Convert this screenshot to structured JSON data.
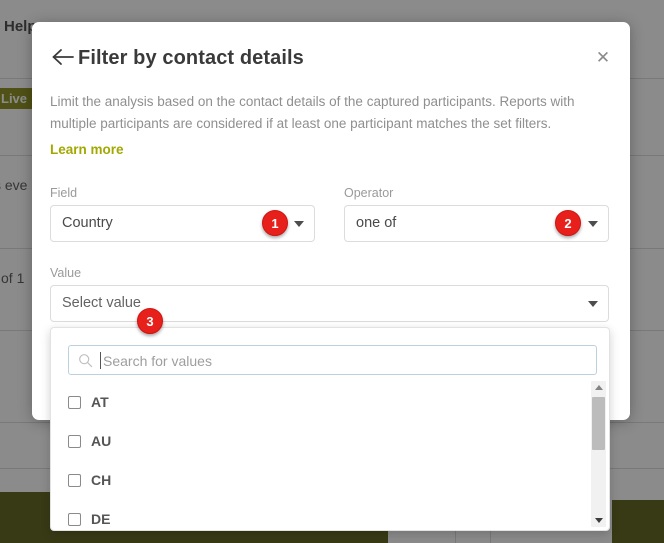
{
  "background": {
    "help_label": "Help",
    "live_chip": "Live",
    "text_fragment_a": "s eve",
    "text_fragment_b": "l of 1",
    "accent_olive": "#4b5000",
    "chip_olive": "#7e8200"
  },
  "modal": {
    "title": "Filter by contact details",
    "back_icon": "back-arrow-icon",
    "close_icon": "close-icon",
    "description": "Limit the analysis based on the contact details of the captured participants. Reports with multiple participants are considered if at least one participant matches the set filters.",
    "learn_more": "Learn more",
    "learn_more_color": "#a3a800",
    "fields": {
      "field": {
        "label": "Field",
        "value": "Country"
      },
      "operator": {
        "label": "Operator",
        "value": "one of"
      },
      "value": {
        "label": "Value",
        "placeholder": "Select value"
      }
    }
  },
  "dropdown": {
    "search_placeholder": "Search for values",
    "search_icon": "search-icon",
    "options": [
      {
        "label": "AT",
        "checked": false
      },
      {
        "label": "AU",
        "checked": false
      },
      {
        "label": "CH",
        "checked": false
      },
      {
        "label": "DE",
        "checked": false
      }
    ],
    "scrollbar": {
      "up_icon": "scroll-up-arrow-icon",
      "down_icon": "scroll-down-arrow-icon"
    }
  },
  "annotations": {
    "badges": [
      {
        "number": "1"
      },
      {
        "number": "2"
      },
      {
        "number": "3"
      }
    ],
    "color": "#e8201c"
  }
}
